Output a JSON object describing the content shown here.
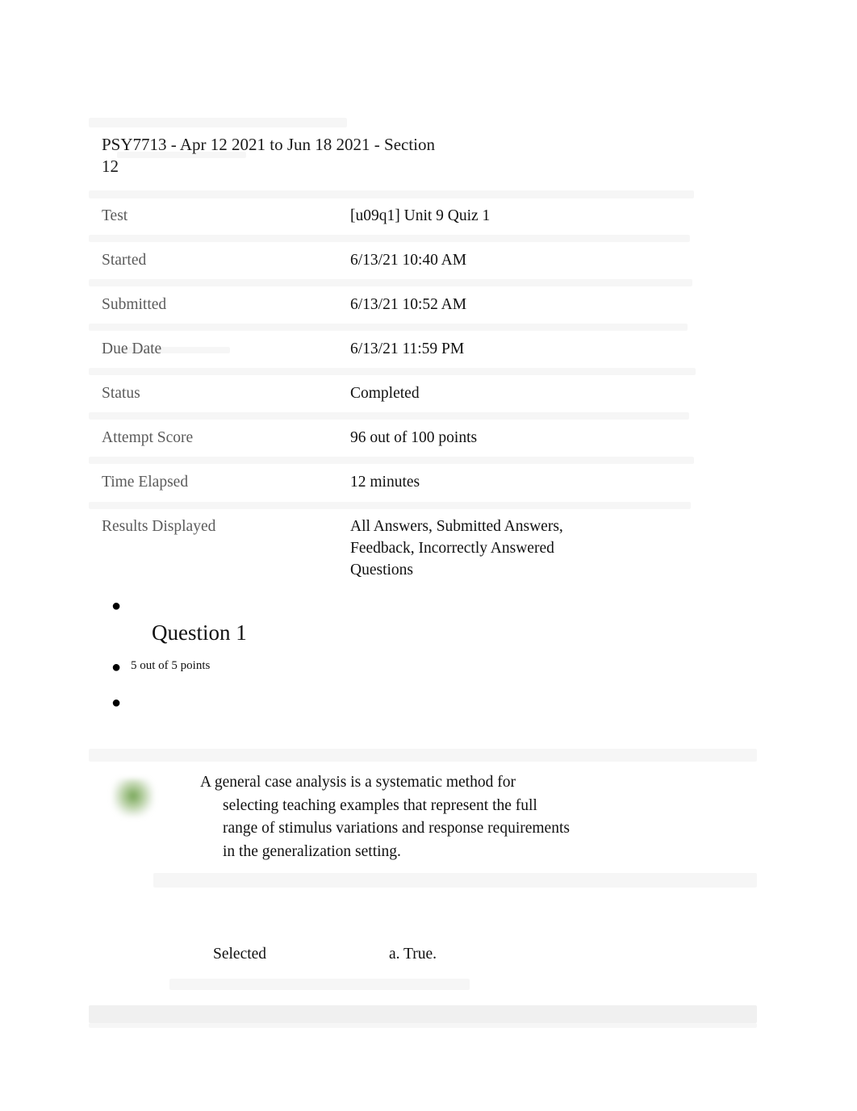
{
  "document": {
    "course_heading": "PSY7713 - Apr 12 2021 to Jun 18 2021 - Section 12",
    "info": [
      {
        "label": "Test",
        "value": "[u09q1] Unit 9 Quiz 1"
      },
      {
        "label": "Started",
        "value": "6/13/21 10:40 AM"
      },
      {
        "label": "Submitted",
        "value": "6/13/21 10:52 AM"
      },
      {
        "label": "Due Date",
        "value": "6/13/21 11:59 PM"
      },
      {
        "label": "Status",
        "value": "Completed"
      },
      {
        "label": "Attempt Score",
        "value": "96 out of 100 points"
      },
      {
        "label": "Time Elapsed",
        "value": "12 minutes"
      },
      {
        "label": "Results Displayed",
        "value": "All Answers, Submitted Answers, Feedback, Incorrectly Answered Questions"
      }
    ],
    "question": {
      "title": "Question 1",
      "points": "5 out of 5 points",
      "statement_line1": "A general case analysis is a systematic method for",
      "statement_line2": "selecting teaching examples that represent the full",
      "statement_line3": "range of stimulus variations and response requirements",
      "statement_line4": "in the generalization setting.",
      "selected_label": "Selected",
      "selected_value": "a. True."
    },
    "bullet_glyph": "●"
  }
}
